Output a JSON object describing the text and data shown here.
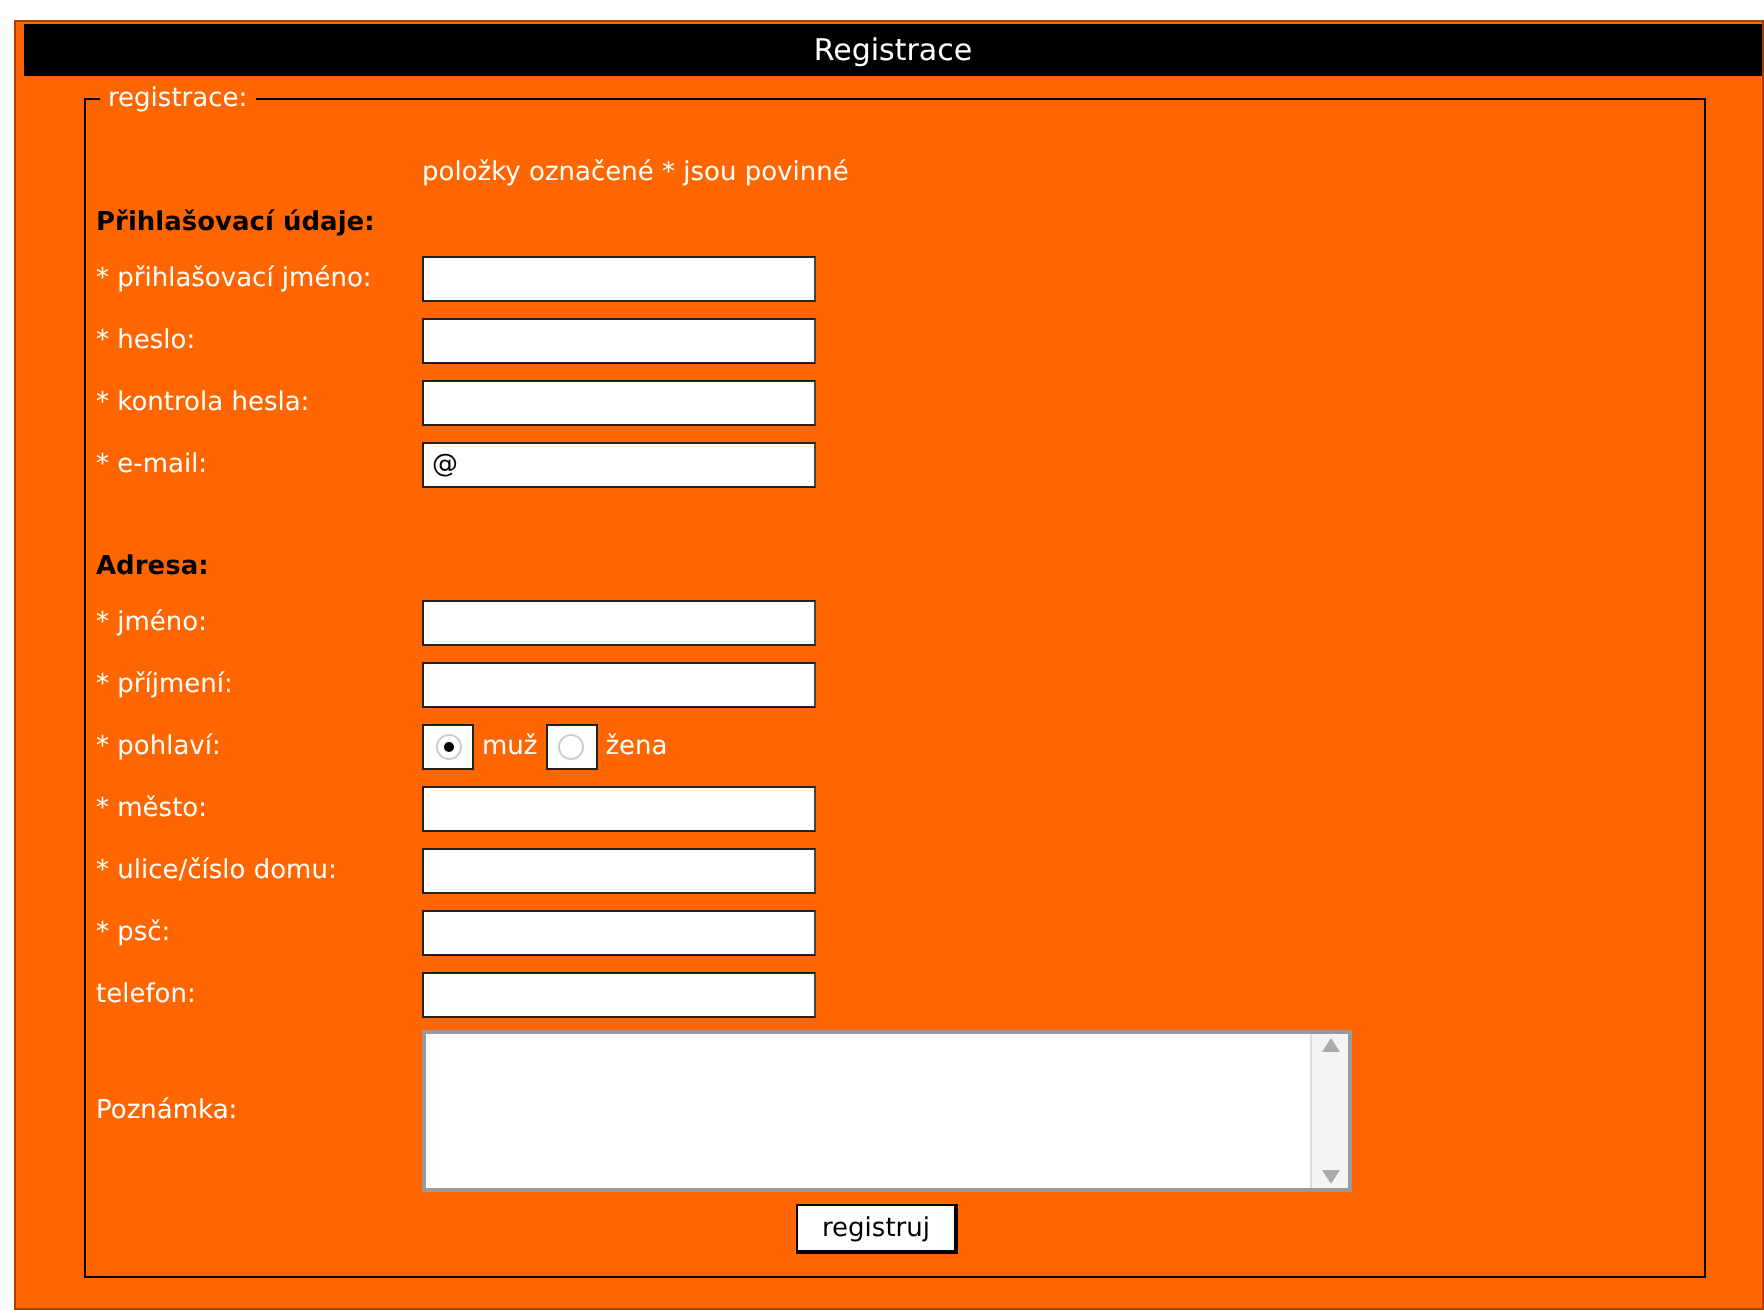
{
  "window": {
    "title": "Registrace"
  },
  "form": {
    "legend": "registrace:",
    "note": "položky označené * jsou povinné",
    "sections": [
      {
        "heading": "Přihlašovací údaje:",
        "fields": [
          {
            "kind": "text",
            "label": "* přihlašovací jméno:"
          },
          {
            "kind": "text",
            "label": "* heslo:"
          },
          {
            "kind": "text",
            "label": "* kontrola hesla:"
          },
          {
            "kind": "text",
            "label": "* e-mail:",
            "value": "@"
          }
        ]
      },
      {
        "heading": "Adresa:",
        "fields": [
          {
            "kind": "text",
            "label": "* jméno:"
          },
          {
            "kind": "text",
            "label": "* příjmení:"
          },
          {
            "kind": "radio",
            "label": "* pohlaví:",
            "options": [
              {
                "label": "muž",
                "selected": true
              },
              {
                "label": "žena",
                "selected": false
              }
            ]
          },
          {
            "kind": "text",
            "label": "* město:"
          },
          {
            "kind": "text",
            "label": "* ulice/číslo domu:"
          },
          {
            "kind": "text",
            "label": "* psč:"
          },
          {
            "kind": "text",
            "label": "telefon:"
          },
          {
            "kind": "textarea",
            "label": "Poznámka:"
          }
        ]
      }
    ],
    "submit": "registruj"
  }
}
